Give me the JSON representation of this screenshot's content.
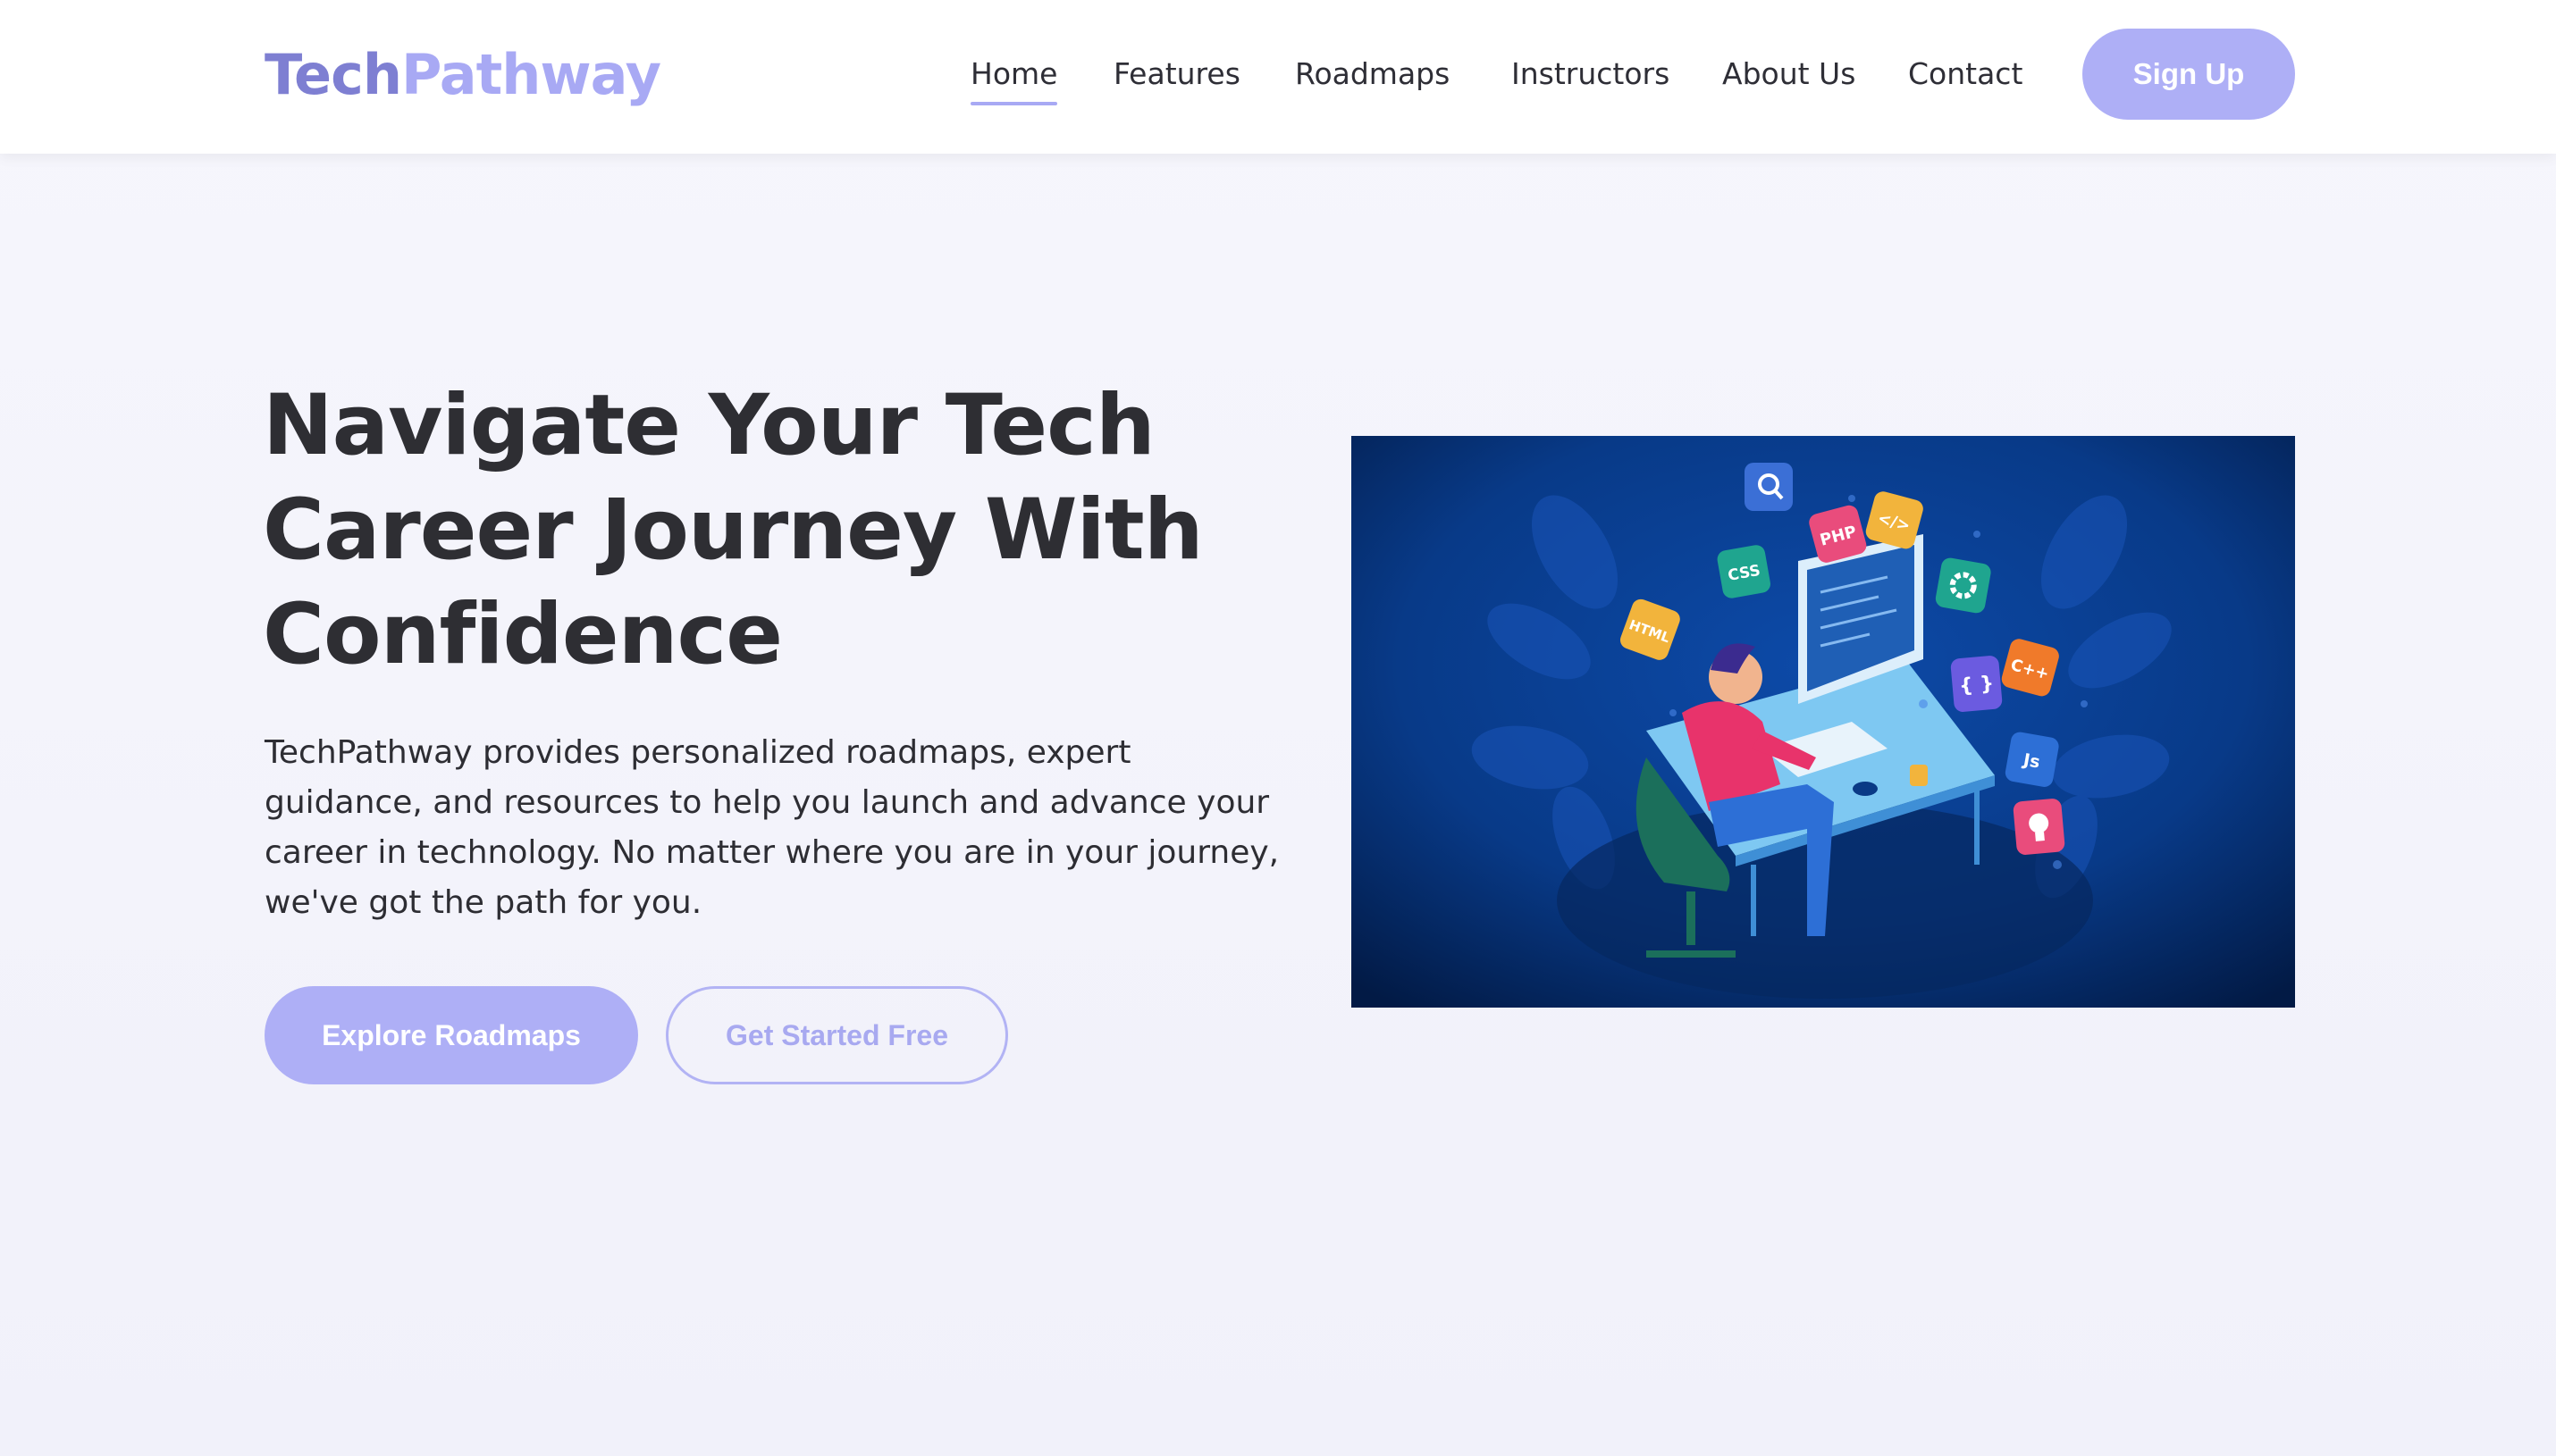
{
  "header": {
    "logo": {
      "part1": "Tech",
      "part2": "Pathway"
    },
    "nav": [
      {
        "label": "Home",
        "active": true
      },
      {
        "label": "Features",
        "active": false
      },
      {
        "label": "Roadmaps",
        "active": false
      },
      {
        "label": "Instructors",
        "active": false
      },
      {
        "label": "About Us",
        "active": false
      },
      {
        "label": "Contact",
        "active": false
      }
    ],
    "signup_label": "Sign Up"
  },
  "hero": {
    "title": "Navigate Your Tech Career Journey With Confidence",
    "description": "TechPathway provides personalized roadmaps, expert guidance, and resources to help you launch and advance your career in technology. No matter where you are in your journey, we've got the path for you.",
    "primary_button": "Explore Roadmaps",
    "secondary_button": "Get Started Free",
    "image": {
      "icons": [
        "search-icon",
        "php-icon",
        "code-icon",
        "css-icon",
        "gear-icon",
        "html-icon",
        "cplusplus-icon",
        "braces-icon",
        "js-icon",
        "lightbulb-icon"
      ],
      "badge_labels": {
        "php": "PHP",
        "css": "CSS",
        "html": "HTML",
        "cpp": "C++",
        "js": "Js",
        "code": "</>",
        "braces": "{ }"
      }
    }
  },
  "colors": {
    "accent": "#aeaff6",
    "logo_dark": "#7e7fd2",
    "logo_light": "#a8a9f4",
    "text": "#2e2e33",
    "image_bg": "#0a3a86"
  }
}
